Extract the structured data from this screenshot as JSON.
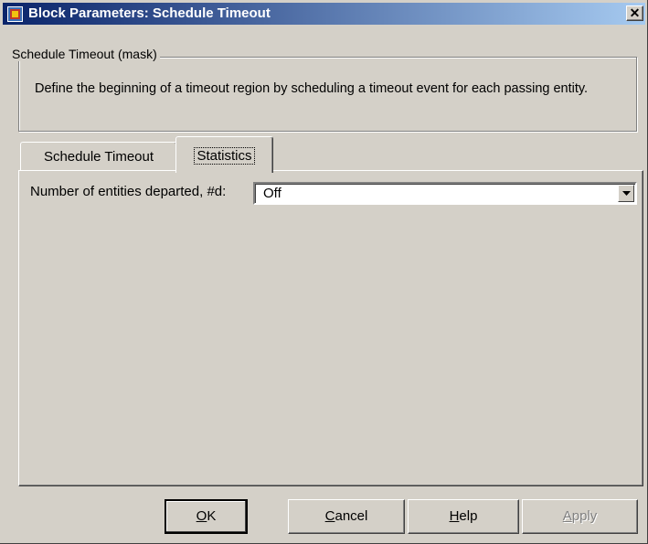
{
  "window": {
    "title": "Block Parameters: Schedule Timeout",
    "close_label": "✕"
  },
  "group": {
    "label": "Schedule Timeout (mask)",
    "description": "Define the beginning of a timeout region by scheduling a timeout event for each passing entity."
  },
  "tabs": [
    {
      "label": "Schedule Timeout",
      "active": false
    },
    {
      "label": "Statistics",
      "active": true
    }
  ],
  "statistics": {
    "departed_label": "Number of entities departed, #d:",
    "departed_value": "Off"
  },
  "buttons": {
    "ok": {
      "mnemonic": "O",
      "rest": "K"
    },
    "cancel": {
      "mnemonic": "C",
      "rest": "ancel"
    },
    "help": {
      "mnemonic": "H",
      "rest": "elp"
    },
    "apply": {
      "mnemonic": "A",
      "rest": "pply",
      "enabled": false
    }
  },
  "icons": {
    "app": "simulink-block-icon",
    "close": "close-icon",
    "dropdown": "chevron-down-icon"
  }
}
